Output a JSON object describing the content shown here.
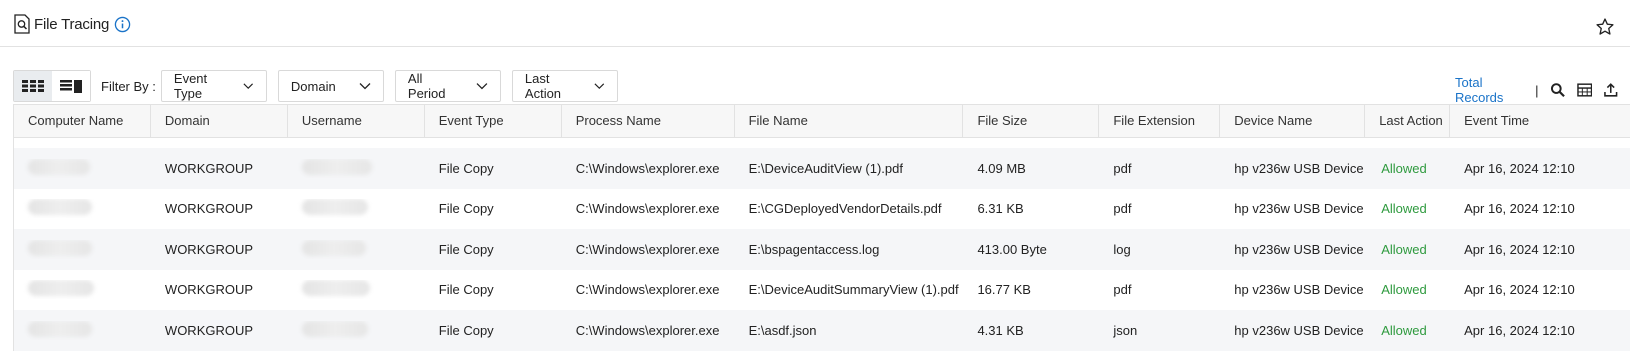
{
  "header": {
    "title": "File Tracing",
    "title_icon": "document-search-icon",
    "info_icon": "info-icon",
    "favorite_icon": "star-icon"
  },
  "toolbar": {
    "views": [
      "grid-view-icon",
      "list-view-icon"
    ],
    "filter_label": "Filter By :",
    "filters": [
      "Event Type",
      "Domain",
      "All Period",
      "Last Action"
    ],
    "total_records_label": "Total Records",
    "separator": "|",
    "tools": [
      "search-icon",
      "columns-icon",
      "export-icon"
    ]
  },
  "colors": {
    "link": "#1a73c8",
    "allowed": "#2e9a3e",
    "header_bg": "#f7f7f7",
    "stripe_bg": "#f5f6f8"
  },
  "table": {
    "columns": [
      "Computer Name",
      "Domain",
      "Username",
      "Event Type",
      "Process Name",
      "File Name",
      "File Size",
      "File Extension",
      "Device Name",
      "Last Action",
      "Event Time"
    ],
    "rows": [
      {
        "computer": "",
        "domain": "WORKGROUP",
        "username": "",
        "event_type": "File Copy",
        "process": "C:\\Windows\\explorer.exe",
        "file_name": "E:\\DeviceAuditView (1).pdf",
        "file_size": "4.09 MB",
        "extension": "pdf",
        "device": "hp v236w USB Device",
        "action": "Allowed",
        "time": "Apr 16, 2024 12:10"
      },
      {
        "computer": "",
        "domain": "WORKGROUP",
        "username": "",
        "event_type": "File Copy",
        "process": "C:\\Windows\\explorer.exe",
        "file_name": "E:\\CGDeployedVendorDetails.pdf",
        "file_size": "6.31 KB",
        "extension": "pdf",
        "device": "hp v236w USB Device",
        "action": "Allowed",
        "time": "Apr 16, 2024 12:10"
      },
      {
        "computer": "",
        "domain": "WORKGROUP",
        "username": "",
        "event_type": "File Copy",
        "process": "C:\\Windows\\explorer.exe",
        "file_name": "E:\\bspagentaccess.log",
        "file_size": "413.00 Byte",
        "extension": "log",
        "device": "hp v236w USB Device",
        "action": "Allowed",
        "time": "Apr 16, 2024 12:10"
      },
      {
        "computer": "",
        "domain": "WORKGROUP",
        "username": "",
        "event_type": "File Copy",
        "process": "C:\\Windows\\explorer.exe",
        "file_name": "E:\\DeviceAuditSummaryView (1).pdf",
        "file_size": "16.77 KB",
        "extension": "pdf",
        "device": "hp v236w USB Device",
        "action": "Allowed",
        "time": "Apr 16, 2024 12:10"
      },
      {
        "computer": "",
        "domain": "WORKGROUP",
        "username": "",
        "event_type": "File Copy",
        "process": "C:\\Windows\\explorer.exe",
        "file_name": "E:\\asdf.json",
        "file_size": "4.31 KB",
        "extension": "json",
        "device": "hp v236w USB Device",
        "action": "Allowed",
        "time": "Apr 16, 2024 12:10"
      }
    ]
  }
}
